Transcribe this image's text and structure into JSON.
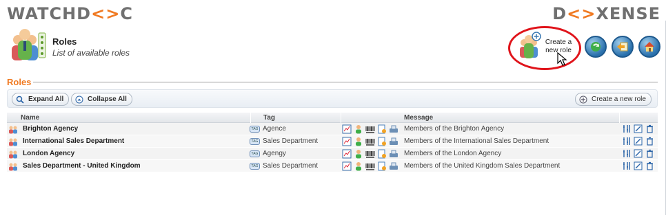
{
  "branding": {
    "left_logo_a": "WATCHD",
    "left_logo_b": "<>",
    "left_logo_c": "C",
    "right_logo_a": "D",
    "right_logo_b": "<>",
    "right_logo_c": "XENSE"
  },
  "header": {
    "title": "Roles",
    "subtitle": "List of available roles",
    "create_label": "Create a new role"
  },
  "section": {
    "title": "Roles"
  },
  "toolbar": {
    "expand_label": "Expand All",
    "collapse_label": "Collapse All",
    "create_label": "Create a new role"
  },
  "table": {
    "columns": [
      "Name",
      "Tag",
      "Message"
    ],
    "rows": [
      {
        "name": "Brighton Agency",
        "tag": "Agence",
        "message": "Members of the Brighton Agency"
      },
      {
        "name": "International Sales Department",
        "tag": "Sales Department",
        "message": "Members of the International Sales Department"
      },
      {
        "name": "London Agency",
        "tag": "Agengy",
        "message": "Members of the London Agency"
      },
      {
        "name": "Sales Department - United Kingdom",
        "tag": "Sales Department",
        "message": "Members of the United Kingdom Sales Department"
      }
    ]
  },
  "colors": {
    "accent": "#f07a22",
    "highlight_ring": "#e0141b"
  },
  "icons": [
    "roles-icon",
    "create-role-icon",
    "refresh-icon",
    "back-icon",
    "home-icon",
    "search-icon",
    "collapse-icon",
    "add-icon",
    "tag-icon",
    "chart-icon",
    "user-icon",
    "barcode-icon",
    "document-icon",
    "printer-icon",
    "settings-icon",
    "edit-icon",
    "delete-icon"
  ]
}
